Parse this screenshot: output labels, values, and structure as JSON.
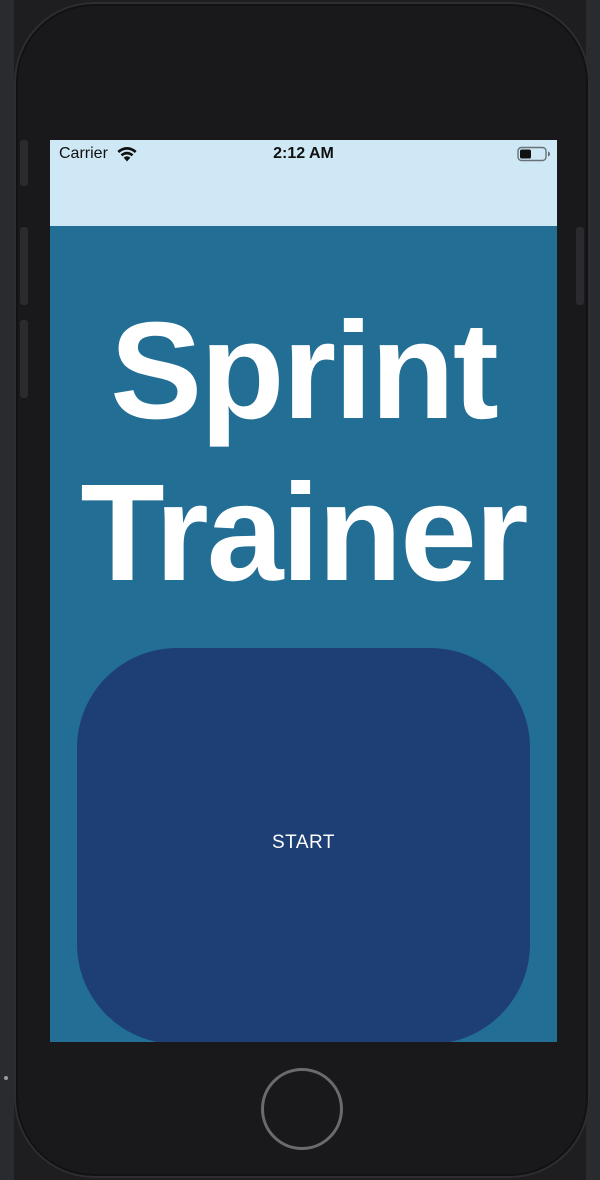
{
  "status_bar": {
    "carrier": "Carrier",
    "time": "2:12 AM",
    "wifi_icon": "wifi-icon",
    "battery_icon": "battery-icon"
  },
  "app": {
    "title": "Sprint Trainer",
    "start_label": "START"
  },
  "colors": {
    "status_bar_bg": "#cfe8f5",
    "screen_bg": "#226e94",
    "start_button_bg": "#1e3f75",
    "title_color": "#ffffff"
  },
  "device": {
    "home_button_icon": "home-button-icon"
  }
}
